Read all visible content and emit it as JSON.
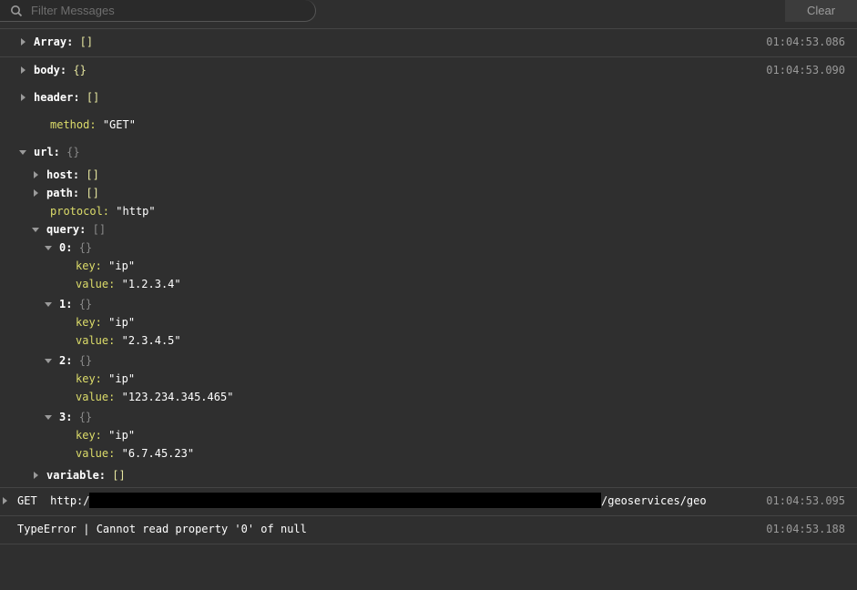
{
  "toolbar": {
    "filter_placeholder": "Filter Messages",
    "clear_label": "Clear"
  },
  "entries": [
    {
      "key": "Array:",
      "value": "[]",
      "timestamp": "01:04:53.086"
    },
    {
      "key": "body:",
      "value": "{}",
      "timestamp": "01:04:53.090"
    }
  ],
  "tree": {
    "header": {
      "key": "header:",
      "value": "[]"
    },
    "method": {
      "key": "method:",
      "value": "\"GET\""
    },
    "url": {
      "key": "url:",
      "value": "{}"
    },
    "host": {
      "key": "host:",
      "value": "[]"
    },
    "path": {
      "key": "path:",
      "value": "[]"
    },
    "protocol": {
      "key": "protocol:",
      "value": "\"http\""
    },
    "query": {
      "key": "query:",
      "value": "[]"
    },
    "items": [
      {
        "index": "0:",
        "brace": "{}",
        "key_label": "key:",
        "key": "\"ip\"",
        "value_label": "value:",
        "value": "\"1.2.3.4\""
      },
      {
        "index": "1:",
        "brace": "{}",
        "key_label": "key:",
        "key": "\"ip\"",
        "value_label": "value:",
        "value": "\"2.3.4.5\""
      },
      {
        "index": "2:",
        "brace": "{}",
        "key_label": "key:",
        "key": "\"ip\"",
        "value_label": "value:",
        "value": "\"123.234.345.465\""
      },
      {
        "index": "3:",
        "brace": "{}",
        "key_label": "key:",
        "key": "\"ip\"",
        "value_label": "value:",
        "value": "\"6.7.45.23\""
      }
    ],
    "variable": {
      "key": "variable:",
      "value": "[]"
    }
  },
  "request": {
    "method": "GET",
    "url_prefix": "http:/",
    "url_suffix": "/geoservices/geo",
    "timestamp": "01:04:53.095"
  },
  "error": {
    "text": "TypeError | Cannot read property '0' of null",
    "timestamp": "01:04:53.188"
  }
}
